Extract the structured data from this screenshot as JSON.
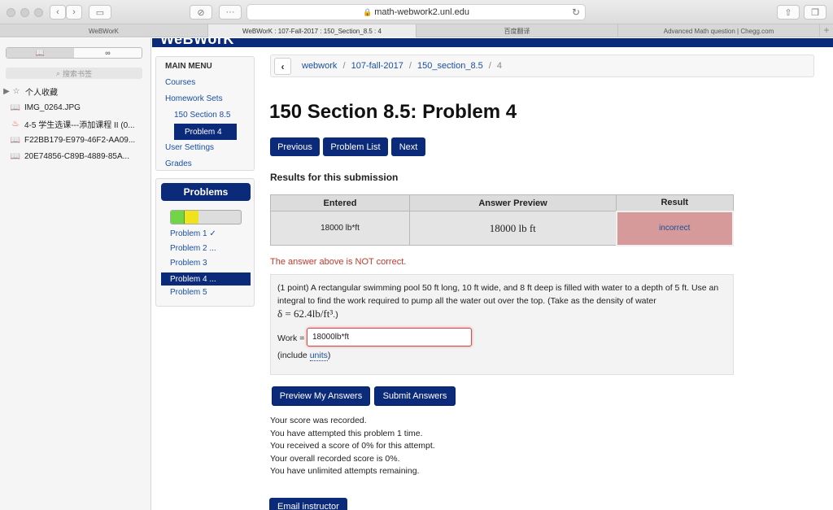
{
  "browser": {
    "url": "math-webwork2.unl.edu",
    "tabs": [
      "WeBWorK",
      "WeBWorK : 107-Fall-2017 : 150_Section_8.5 : 4",
      "百度翻译",
      "Advanced Math question | Chegg.com"
    ],
    "new_tab": "+"
  },
  "sidebar": {
    "search_placeholder": "搜索书签",
    "folder": "个人收藏",
    "bookmarks": [
      "IMG_0264.JPG",
      "4-5 学生选课---添加课程 II (0...",
      "F22BB179-E979-46F2-AA09...",
      "20E74856-C89B-4889-85A..."
    ]
  },
  "header": {
    "logo": "WeBWorK"
  },
  "main_menu": {
    "title": "MAIN MENU",
    "courses": "Courses",
    "homework_sets": "Homework Sets",
    "section": "150 Section 8.5",
    "problem": "Problem 4",
    "user_settings": "User Settings",
    "grades": "Grades"
  },
  "problems_panel": {
    "button": "Problems",
    "progress": {
      "correct_fraction": 0.2,
      "incorrect_fraction": 0.2
    },
    "items": [
      "Problem 1 ✓",
      "Problem 2 ...",
      "Problem 3",
      "Problem 4 ...",
      "Problem 5"
    ]
  },
  "breadcrumb": {
    "back": "‹",
    "parts": [
      "webwork",
      "107-fall-2017",
      "150_section_8.5"
    ],
    "current": "4",
    "sep": "/"
  },
  "title": "150 Section 8.5: Problem 4",
  "nav": {
    "previous": "Previous",
    "problem_list": "Problem List",
    "next": "Next"
  },
  "results": {
    "heading": "Results for this submission",
    "columns": [
      "Entered",
      "Answer Preview",
      "Result"
    ],
    "row": {
      "entered": "18000 lb*ft",
      "preview": "18000 lb ft",
      "result": "incorrect"
    },
    "message": "The answer above is NOT correct."
  },
  "problem": {
    "text": "(1 point) A rectangular swimming pool 50 ft long, 10 ft wide, and 8 ft deep is filled with water to a depth of 5 ft. Use an integral to find the work required to pump all the water out over the top. (Take as the density of water",
    "density_math": "δ = 62.4lb/ft³",
    "density_suffix": ".)",
    "work_label": "Work =",
    "answer_value": "18000lb*ft",
    "include_prefix": "(include ",
    "units_link": "units",
    "include_suffix": ")"
  },
  "actions": {
    "preview": "Preview My Answers",
    "submit": "Submit Answers",
    "email": "Email instructor"
  },
  "score_lines": [
    "Your score was recorded.",
    "You have attempted this problem 1 time.",
    "You received a score of 0% for this attempt.",
    "Your overall recorded score is 0%.",
    "You have unlimited attempts remaining."
  ],
  "colors": {
    "nav_blue": "#0b2a7a",
    "link_blue": "#1a4fa0",
    "error_red": "#c0392b",
    "incorrect_bg": "#d79a9a"
  }
}
